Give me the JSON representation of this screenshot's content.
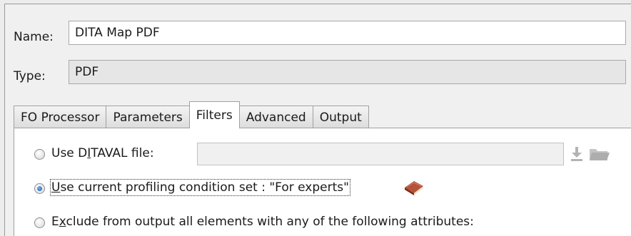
{
  "form": {
    "name_label": "Name:",
    "name_value": "DITA Map PDF",
    "type_label": "Type:",
    "type_value": "PDF"
  },
  "tabs": [
    {
      "label": "FO Processor",
      "active": false
    },
    {
      "label": "Parameters",
      "active": false
    },
    {
      "label": "Filters",
      "active": true
    },
    {
      "label": "Advanced",
      "active": false
    },
    {
      "label": "Output",
      "active": false
    }
  ],
  "filters": {
    "ditaval_option": {
      "pre": "Use D",
      "mnemonic": "I",
      "post": "TAVAL file:",
      "checked": false
    },
    "ditaval_path": "",
    "profiling_option": {
      "mnemonic": "U",
      "post": "se current profiling condition set : \"For experts\"",
      "checked": true
    },
    "exclude_option": {
      "pre": "E",
      "mnemonic": "x",
      "post": "clude from output all elements with any of the following attributes:",
      "checked": false
    }
  },
  "icons": {
    "download": "download-icon",
    "folder": "folder-icon",
    "book": "book-icon"
  },
  "colors": {
    "accent_radio": "#1a5fb4",
    "book": "#a0402a"
  }
}
